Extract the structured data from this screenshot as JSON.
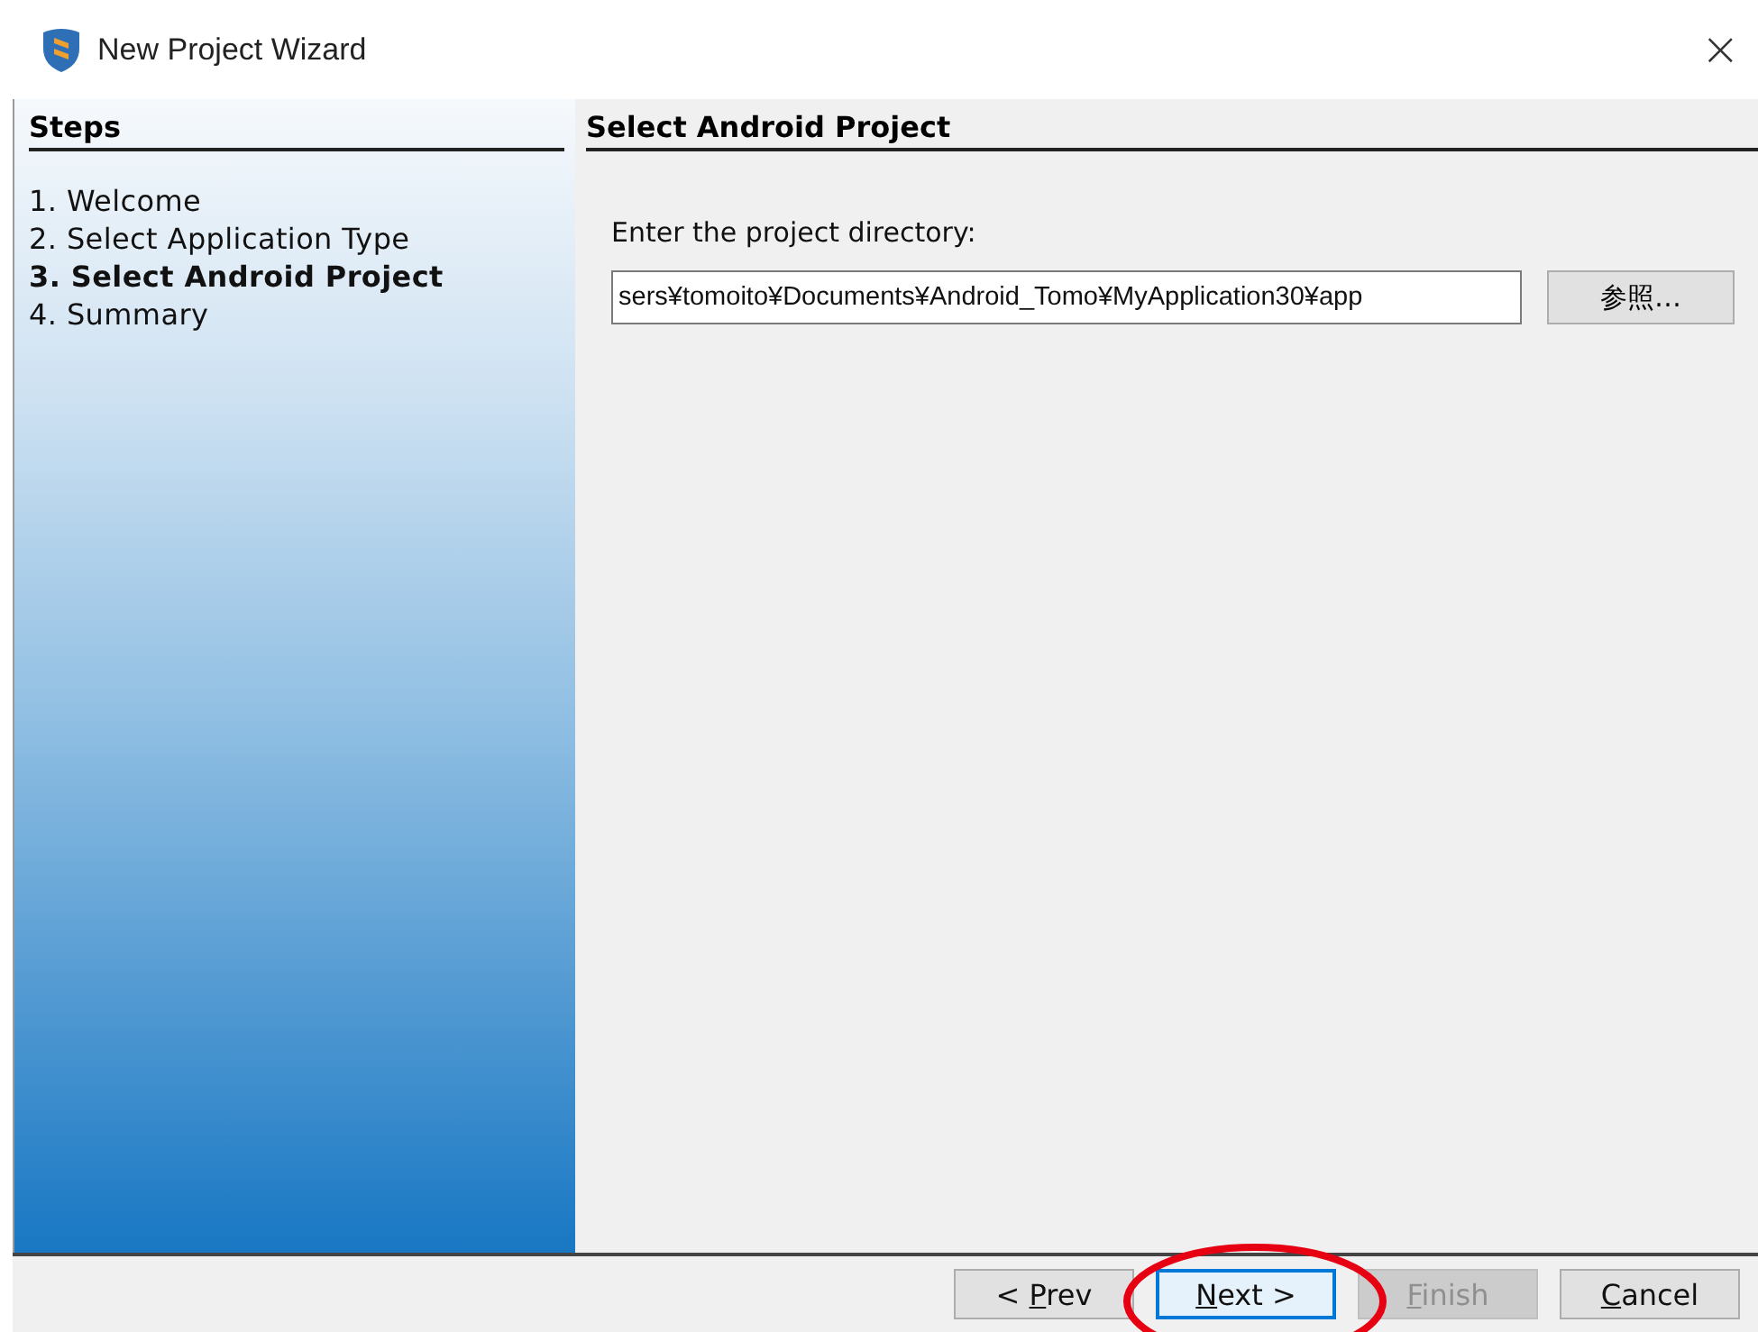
{
  "window": {
    "title": "New Project Wizard",
    "close": "×"
  },
  "steps": {
    "heading": "Steps",
    "items": [
      {
        "label": "1. Welcome",
        "selected": false
      },
      {
        "label": "2. Select Application Type",
        "selected": false
      },
      {
        "label": "3. Select Android Project",
        "selected": true
      },
      {
        "label": "4. Summary",
        "selected": false
      }
    ]
  },
  "panel": {
    "heading": "Select Android Project",
    "prompt": "Enter the project directory:",
    "directory": "sers¥tomoito¥Documents¥Android_Tomo¥MyApplication30¥app",
    "browse": "参照…"
  },
  "buttons": [
    {
      "pre": "< ",
      "key": "P",
      "post": "rev",
      "disabled": false,
      "focused": false
    },
    {
      "key": "N",
      "post": "ext >",
      "disabled": false,
      "focused": true
    },
    {
      "key": "F",
      "post": "inish",
      "disabled": true,
      "focused": false
    },
    {
      "key": "C",
      "post": "ancel",
      "disabled": false,
      "focused": false
    }
  ],
  "highlight": {
    "kind": "ellipse"
  }
}
